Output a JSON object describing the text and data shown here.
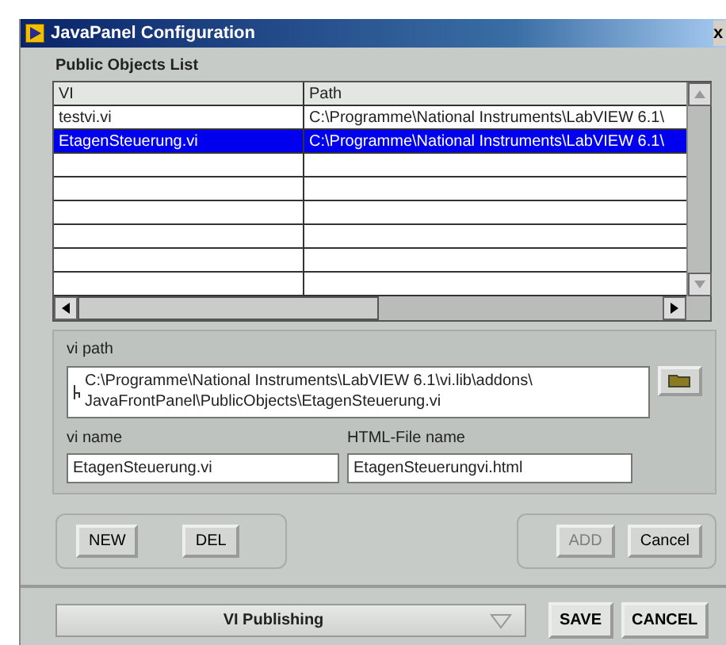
{
  "window": {
    "title": "JavaPanel Configuration",
    "close": "x"
  },
  "public_objects": {
    "label": "Public Objects List",
    "columns": [
      "VI",
      "Path"
    ],
    "rows": [
      {
        "vi": "testvi.vi",
        "path": "C:\\Programme\\National Instruments\\LabVIEW 6.1\\",
        "selected": false
      },
      {
        "vi": "EtagenSteuerung.vi",
        "path": "C:\\Programme\\National Instruments\\LabVIEW 6.1\\",
        "selected": true
      }
    ]
  },
  "vi_path": {
    "label": "vi path",
    "value": "C:\\Programme\\National Instruments\\LabVIEW 6.1\\vi.lib\\addons\\\nJavaFrontPanel\\PublicObjects\\EtagenSteuerung.vi"
  },
  "vi_name": {
    "label": "vi name",
    "value": "EtagenSteuerung.vi"
  },
  "html_file": {
    "label": "HTML-File name",
    "value": "EtagenSteuerungvi.html"
  },
  "buttons_left": [
    {
      "label": "NEW",
      "disabled": false
    },
    {
      "label": "DEL",
      "disabled": false
    }
  ],
  "buttons_right": [
    {
      "label": "ADD",
      "disabled": true
    },
    {
      "label": "Cancel",
      "disabled": false
    }
  ],
  "footer": {
    "dropdown": "VI Publishing",
    "buttons": [
      "SAVE",
      "CANCEL"
    ]
  }
}
